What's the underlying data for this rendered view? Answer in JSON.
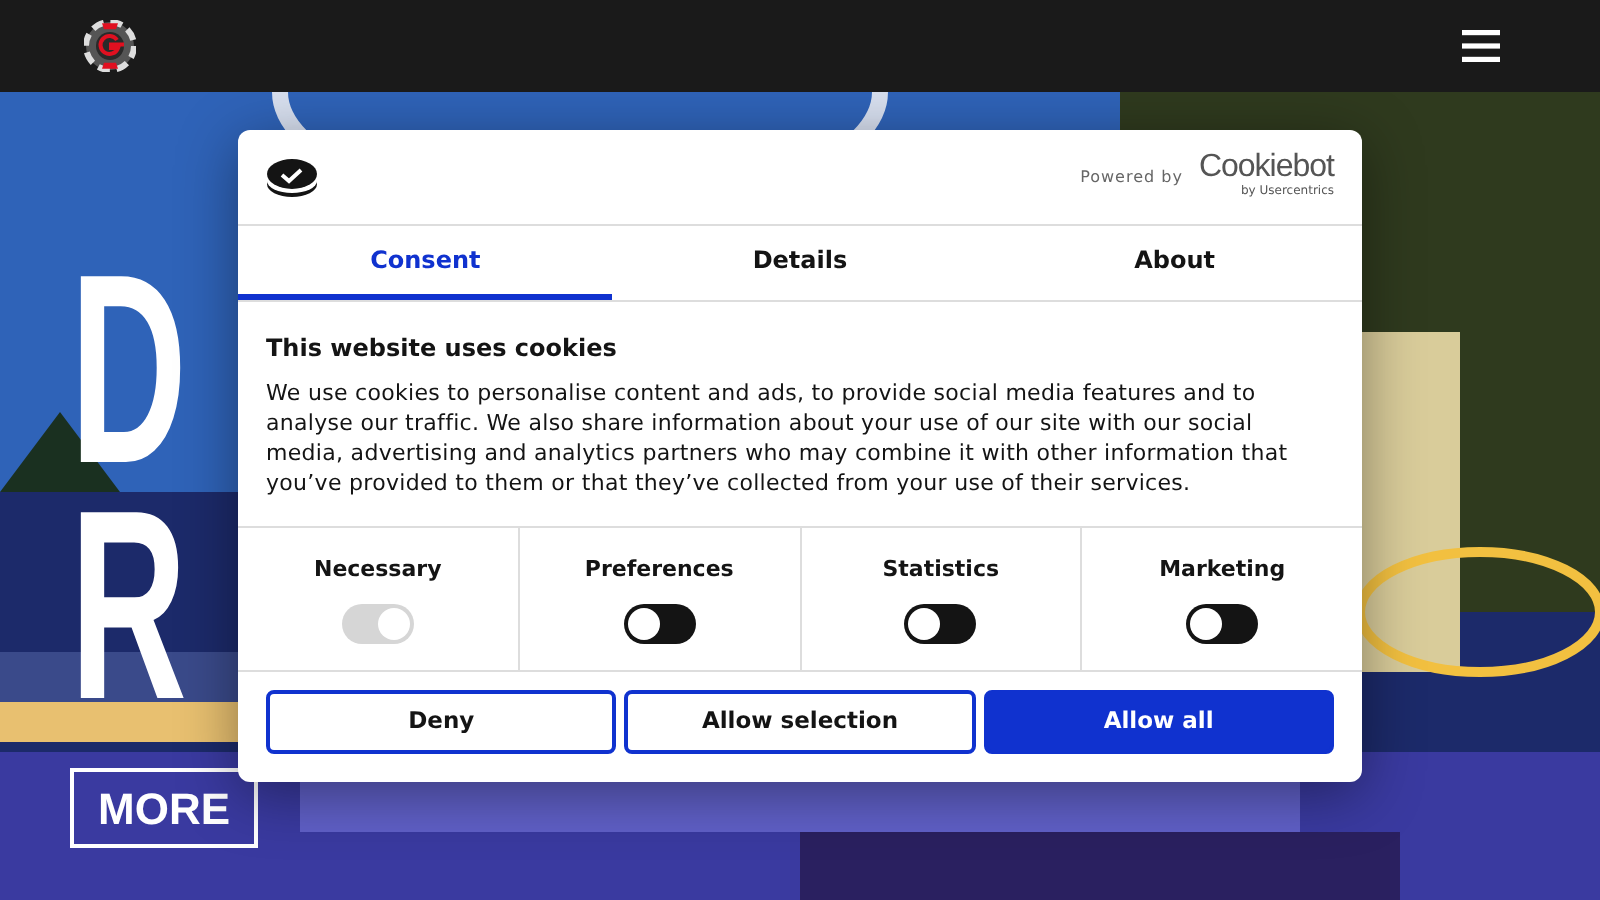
{
  "hero": {
    "kind": "picture",
    "headline": [
      "D",
      "R"
    ],
    "button": "MORE"
  },
  "dialog": {
    "powered_by": "Powered by",
    "brand": "Cookiebot",
    "brand_sub": "by Usercentrics",
    "tabs": [
      {
        "label": "Consent",
        "selected": true
      },
      {
        "label": "Details",
        "selected": false
      },
      {
        "label": "About",
        "selected": false
      }
    ],
    "title": "This website uses cookies",
    "body": "We use cookies to personalise content and ads, to provide social media features and to analyse our traffic. We also share information about your use of our site with our social media, advertising and analytics partners who may combine it with other information that you’ve provided to them or that they’ve collected from your use of their services.",
    "categories": [
      {
        "label": "Necessary",
        "checked": true,
        "disabled": true
      },
      {
        "label": "Preferences",
        "checked": false,
        "disabled": false
      },
      {
        "label": "Statistics",
        "checked": false,
        "disabled": false
      },
      {
        "label": "Marketing",
        "checked": false,
        "disabled": false
      }
    ],
    "buttons": [
      {
        "label": "Deny",
        "kind": "outline"
      },
      {
        "label": "Allow selection",
        "kind": "outline"
      },
      {
        "label": "Allow all",
        "kind": "primary"
      }
    ]
  }
}
